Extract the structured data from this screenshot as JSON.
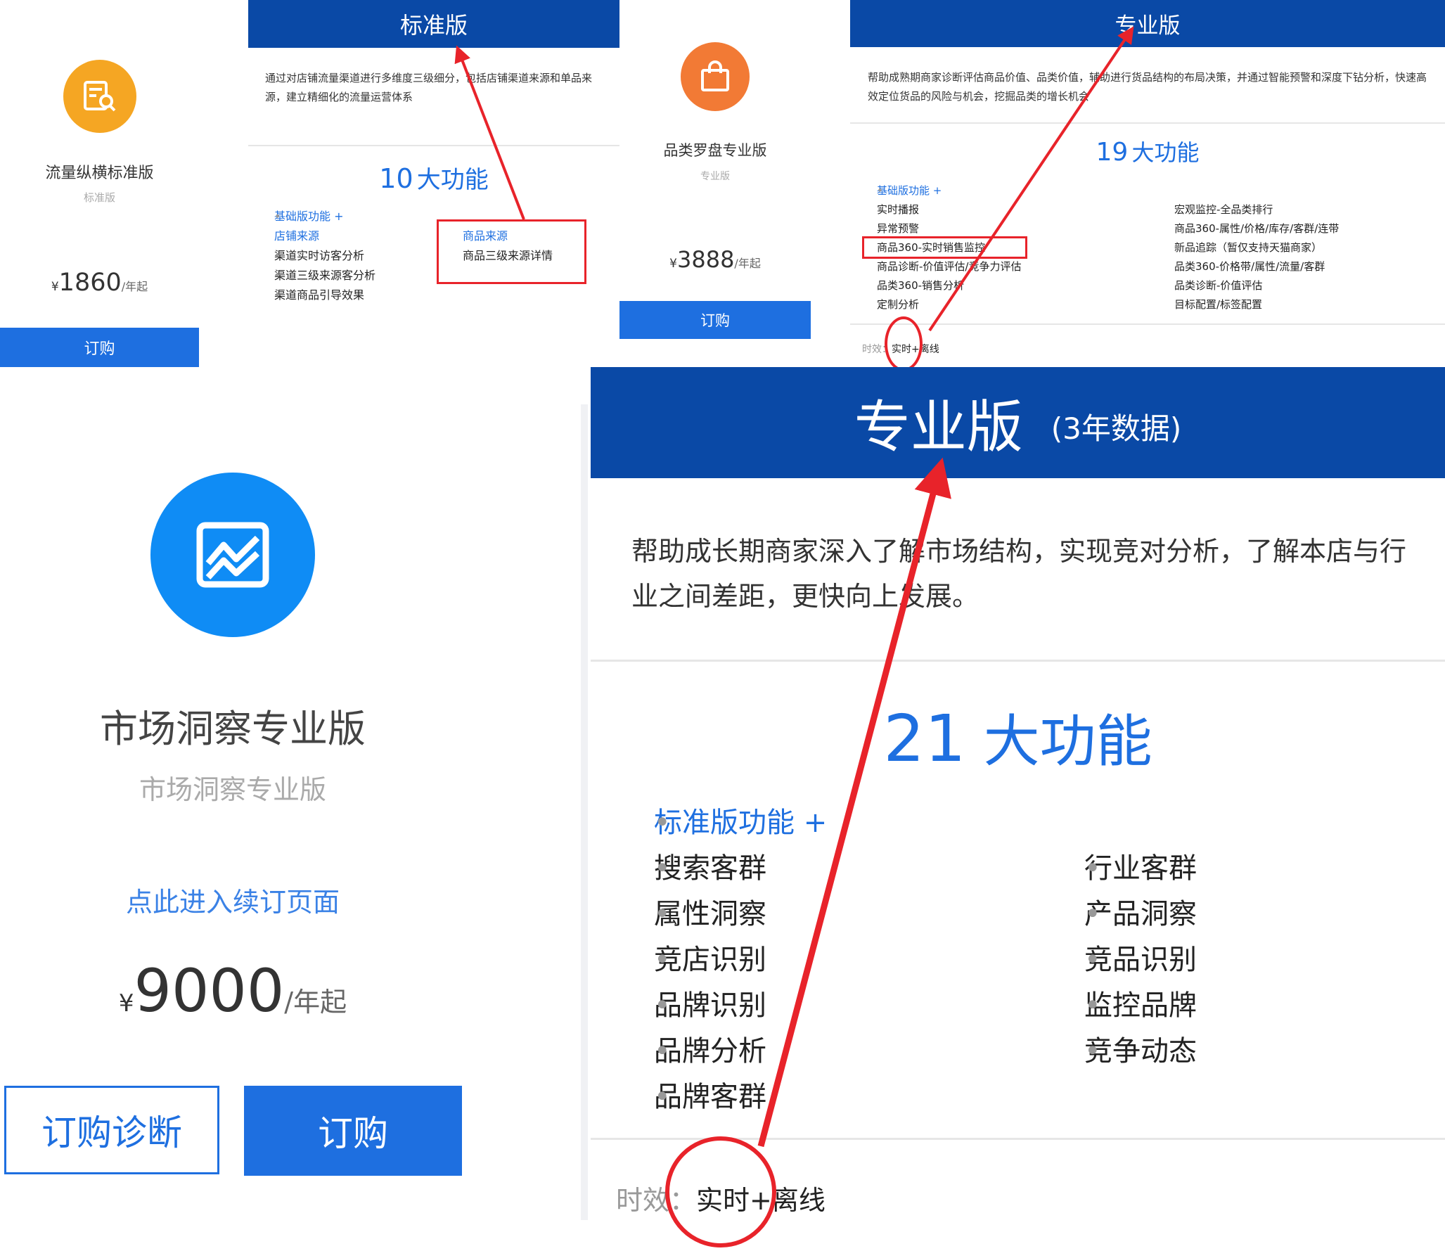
{
  "colors": {
    "header_blue": "#0a49a6",
    "button_blue": "#1e6fe0",
    "link_blue": "#1e6fe0",
    "annotation_red": "#e8232a",
    "orange_yellow": "#f5a623",
    "orange": "#f27a35",
    "bright_blue": "#0f8cf5"
  },
  "product1": {
    "icon": "doc-search-icon",
    "name": "流量纵横标准版",
    "subname": "标准版",
    "price_symbol": "¥",
    "price": "1860",
    "price_unit": "/年起",
    "order_label": "订购"
  },
  "panel1": {
    "header": "标准版",
    "desc": "通过对店铺流量渠道进行多维度三级细分，包括店铺渠道来源和单品来源，建立精细化的流量运营体系",
    "count_num": "10",
    "count_label": "大功能",
    "left_features": [
      "基础版功能 +",
      "店铺来源",
      "渠道实时访客分析",
      "渠道三级来源客分析",
      "渠道商品引导效果"
    ],
    "right_features": [
      "商品来源",
      "商品三级来源详情"
    ]
  },
  "product2": {
    "icon": "shopping-bag-icon",
    "name": "品类罗盘专业版",
    "subname": "专业版",
    "price_symbol": "¥",
    "price": "3888",
    "price_unit": "/年起",
    "order_label": "订购"
  },
  "panel2": {
    "header": "专业版",
    "desc": "帮助成熟期商家诊断评估商品价值、品类价值，辅助进行货品结构的布局决策，并通过智能预警和深度下钻分析，快速高效定位货品的风险与机会，挖掘品类的增长机会",
    "count_num": "19",
    "count_label": "大功能",
    "left_features": [
      "基础版功能 +",
      "实时播报",
      "异常预警",
      "商品360-实时销售监控",
      "商品诊断-价值评估/竞争力评估",
      "品类360-销售分析",
      "定制分析"
    ],
    "right_features": [
      "宏观监控-全品类排行",
      "商品360-属性/价格/库存/客群/连带",
      "新品追踪（暂仅支持天猫商家）",
      "品类360-价格带/属性/流量/客群",
      "品类诊断-价值评估",
      "目标配置/标签配置"
    ],
    "timeliness_label": "时效：",
    "timeliness_value": "实时+离线"
  },
  "product3": {
    "icon": "trend-chart-icon",
    "name": "市场洞察专业版",
    "subname": "市场洞察专业版",
    "renew_link": "点此进入续订页面",
    "price_symbol": "¥",
    "price": "9000",
    "price_unit": "/年起",
    "diagnose_label": "订购诊断",
    "order_label": "订购"
  },
  "panel3": {
    "header": "专业版",
    "header_note": "(3年数据)",
    "desc": "帮助成长期商家深入了解市场结构，实现竞对分析，了解本店与行业之间差距，更快向上发展。",
    "count_num": "21",
    "count_label": "大功能",
    "left_features": [
      "标准版功能 +",
      "搜索客群",
      "属性洞察",
      "竞店识别",
      "品牌识别",
      "品牌分析",
      "品牌客群"
    ],
    "right_features": [
      "行业客群",
      "产品洞察",
      "竞品识别",
      "监控品牌",
      "竞争动态"
    ],
    "timeliness_label": "时效：",
    "timeliness_value": "实时+离线"
  }
}
